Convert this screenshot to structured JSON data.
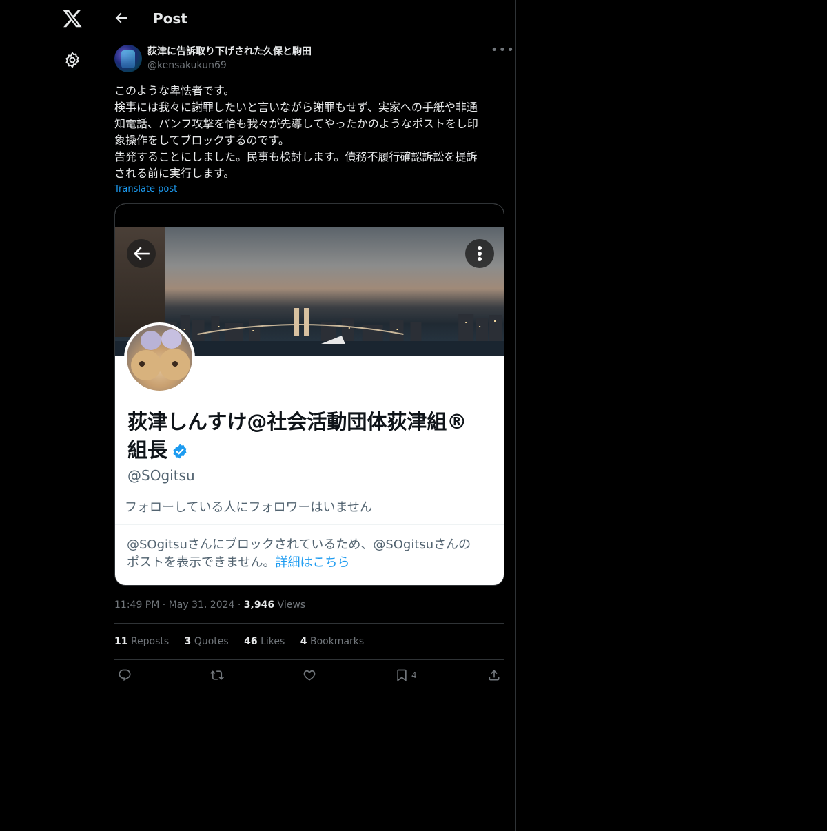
{
  "nav": {
    "logo_icon": "x-logo-icon",
    "settings_icon": "gear-icon"
  },
  "header": {
    "title": "Post",
    "back_icon": "arrow-left-icon"
  },
  "post": {
    "author_name": "荻津に告訴取り下げされた久保と駒田",
    "author_handle": "@kensakukun69",
    "more_icon": "ellipsis-icon",
    "text_lines": [
      "このような卑怯者です。",
      "検事には我々に謝罪したいと言いながら謝罪もせず、実家への手紙や非通",
      "知電話、パンフ攻撃を恰も我々が先導してやったかのようなポストをし印",
      "象操作をしてブロックするのです。",
      "告発することにしました。民事も検討します。債務不履行確認訴訟を提訴",
      "される前に実行します。"
    ],
    "translate_label": "Translate post",
    "time": "11:49 PM",
    "date": "May 31, 2024",
    "views_count": "3,946",
    "views_label": "Views",
    "dot": "·"
  },
  "embedded": {
    "name_line1": "荻津しんすけ@社会活動団体荻津組®",
    "name_line2": "組長",
    "verified_icon": "verified-badge-icon",
    "handle": "@SOgitsu",
    "followers_note": "フォローしている人にフォロワーはいません",
    "block_line1": "@SOgitsuさんにブロックされているため、@SOgitsuさんの",
    "block_line2": "ポストを表示できません。",
    "block_link": "詳細はこちら"
  },
  "stats": [
    {
      "count": "11",
      "label": "Reposts"
    },
    {
      "count": "3",
      "label": "Quotes"
    },
    {
      "count": "46",
      "label": "Likes"
    },
    {
      "count": "4",
      "label": "Bookmarks"
    }
  ],
  "actions": {
    "bookmark_count": "4"
  },
  "colors": {
    "background": "#000000",
    "accent": "#1d9bf0",
    "text": "#e7e9ea",
    "muted": "#71767b",
    "border": "#2f3336"
  }
}
